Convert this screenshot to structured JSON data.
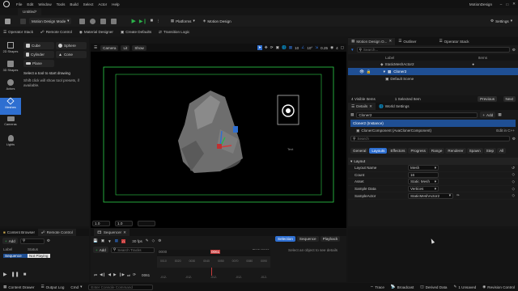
{
  "menu": {
    "items": [
      "File",
      "Edit",
      "Window",
      "Tools",
      "Build",
      "Select",
      "Actor",
      "Help"
    ],
    "project": "MotionDesign",
    "doc_tab": "Untitled*"
  },
  "toolbar": {
    "mode_label": "Motion Design Mode",
    "platforms_label": "Platforms",
    "motion_design_label": "Motion Design",
    "settings_label": "Settings"
  },
  "secondary_toolbar": {
    "items": [
      "Operator Stack",
      "Remote Control",
      "Material Designer",
      "Create Defaults",
      "Transition Logic"
    ]
  },
  "left_palette": {
    "categories": [
      "2D Shapes",
      "3D Shapes",
      "Actors",
      "Meshes",
      "Cameras",
      "Lights"
    ],
    "active_category": "Meshes",
    "shapes": [
      "Cube",
      "Sphere",
      "Cylinder",
      "Cone",
      "Plane"
    ],
    "hint_title": "Select a tool to start drawing",
    "hint_body": "Shift click will show tool presets, if available."
  },
  "viewport": {
    "camera_label": "Camera",
    "lit_label": "Lit",
    "view_label": "Show",
    "grid_snap": "10",
    "rotation_snap": "10°",
    "scale_snap": "0.25",
    "cam_speed": "4",
    "text_label": "Text",
    "field_values": [
      "1.0",
      "1.0"
    ]
  },
  "outliner": {
    "tabs": [
      "Motion Design O...",
      "Outliner",
      "Operator Stack"
    ],
    "search_placeholder": "Search...",
    "col_label": "Label",
    "col_items": "Items",
    "rows": [
      "StaticMeshActor2",
      "Cloner2",
      "Default Scene"
    ],
    "footer_left": "4 Visible Items",
    "footer_mid": "1 Selected Item",
    "prev_label": "Previous",
    "next_label": "Next"
  },
  "details": {
    "tabs": [
      "Details",
      "World Settings"
    ],
    "object_name": "Cloner2",
    "add_label": "Add",
    "component_root": "Cloner2 (Instance)",
    "component_child": "ClonerComponent (AvaClonerComponent)",
    "edit_link": "Edit in C++",
    "search_placeholder": "Search",
    "filter_tabs": [
      "General",
      "Layouts",
      "Effectors",
      "Progress",
      "Range",
      "Renderer",
      "Spawn",
      "Step",
      "All"
    ],
    "active_filter": "Layouts",
    "section": "Layout",
    "props": [
      {
        "label": "Layout Name",
        "value": "Mesh"
      },
      {
        "label": "Count",
        "value": "16"
      },
      {
        "label": "Asset",
        "value": "Static Mesh"
      },
      {
        "label": "Sample Data",
        "value": "Vertices"
      },
      {
        "label": "SampleActor",
        "value": "StaticMeshActor2"
      }
    ]
  },
  "content_browser": {
    "tabs": [
      "Content Browser",
      "Remote Control"
    ],
    "add_label": "Add",
    "col_label": "Label",
    "col_status": "Status",
    "row_label": "Sequence",
    "row_status": "Not Playing"
  },
  "sequencer": {
    "tab": "Sequencer",
    "add_label": "Add",
    "search_placeholder": "Search Tracks",
    "fps": "30 fps",
    "sequence_name": "Sequence",
    "frame": "0061",
    "frame_field": "0061",
    "ruler_start": "0000",
    "panel_tabs": [
      "Selection",
      "Sequence",
      "Playback"
    ],
    "panel_hint": "Select an object to see details",
    "ruler_marks": [
      "0010",
      "0020",
      "0030",
      "0040",
      "0050",
      "0070",
      "0080",
      "0090",
      "0100",
      "0110"
    ],
    "bottom_marks": [
      "-012-",
      "-012-",
      "-012-",
      "-012-",
      "-012-"
    ]
  },
  "status_bar": {
    "content_drawer": "Content Drawer",
    "output_log": "Output Log",
    "cmd": "Cmd",
    "cmd_placeholder": "Enter Console Command",
    "trace": "Trace",
    "broadcast": "Broadcast",
    "derived_data": "Derived Data",
    "unsaved": "1 Unsaved",
    "revision": "Revision Control"
  },
  "colors": {
    "accent": "#2e6fd1",
    "selection": "#1f4f94",
    "play_green": "#2bb34a",
    "record_red": "#c73b3b",
    "safe_frame_green": "#2fd14a"
  }
}
